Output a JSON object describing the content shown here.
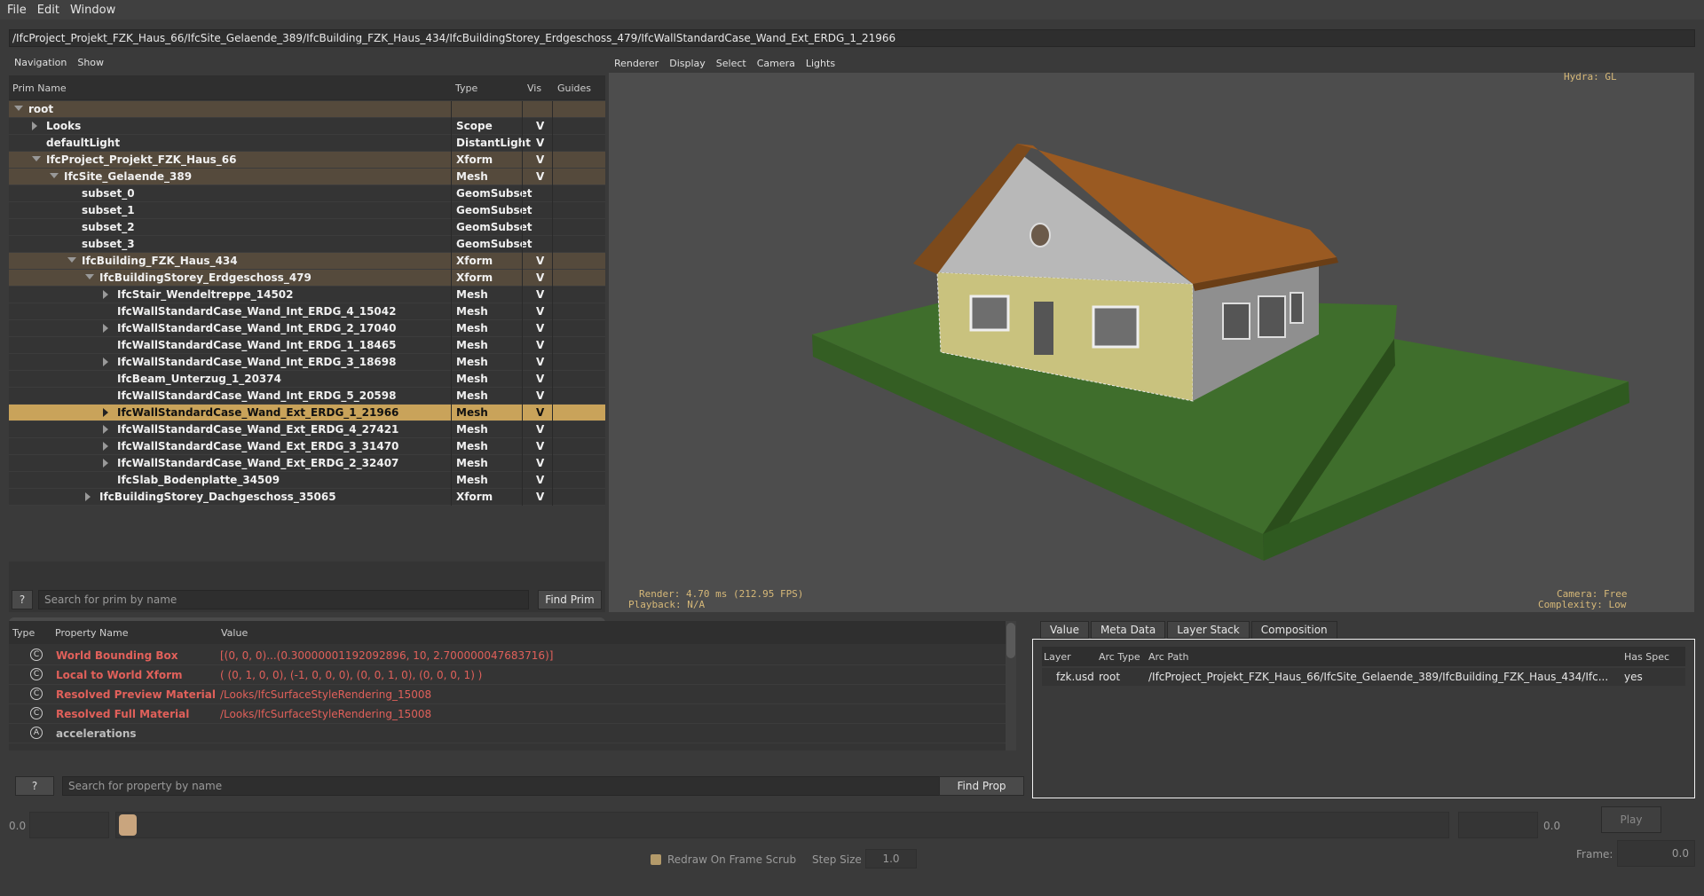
{
  "menu": [
    "File",
    "Edit",
    "Window"
  ],
  "path": "/IfcProject_Projekt_FZK_Haus_66/IfcSite_Gelaende_389/IfcBuilding_FZK_Haus_434/IfcBuildingStorey_Erdgeschoss_479/IfcWallStandardCase_Wand_Ext_ERDG_1_21966",
  "prim_panel": {
    "tabs": [
      "Navigation",
      "Show"
    ],
    "columns": [
      "Prim Name",
      "Type",
      "Vis",
      "Guides"
    ],
    "rows": [
      {
        "name": "root",
        "type": "",
        "vis": "",
        "depth": 0,
        "expander": "down",
        "style": "hl"
      },
      {
        "name": "Looks",
        "type": "Scope",
        "vis": "V",
        "depth": 1,
        "expander": "right",
        "style": ""
      },
      {
        "name": "defaultLight",
        "type": "DistantLight",
        "vis": "V",
        "depth": 1,
        "expander": "",
        "style": ""
      },
      {
        "name": "IfcProject_Projekt_FZK_Haus_66",
        "type": "Xform",
        "vis": "V",
        "depth": 1,
        "expander": "down",
        "style": "hl"
      },
      {
        "name": "IfcSite_Gelaende_389",
        "type": "Mesh",
        "vis": "V",
        "depth": 2,
        "expander": "down",
        "style": "hl"
      },
      {
        "name": "subset_0",
        "type": "GeomSubset",
        "vis": "",
        "depth": 3,
        "expander": "",
        "style": ""
      },
      {
        "name": "subset_1",
        "type": "GeomSubset",
        "vis": "",
        "depth": 3,
        "expander": "",
        "style": ""
      },
      {
        "name": "subset_2",
        "type": "GeomSubset",
        "vis": "",
        "depth": 3,
        "expander": "",
        "style": ""
      },
      {
        "name": "subset_3",
        "type": "GeomSubset",
        "vis": "",
        "depth": 3,
        "expander": "",
        "style": ""
      },
      {
        "name": "IfcBuilding_FZK_Haus_434",
        "type": "Xform",
        "vis": "V",
        "depth": 3,
        "expander": "down",
        "style": "hl"
      },
      {
        "name": "IfcBuildingStorey_Erdgeschoss_479",
        "type": "Xform",
        "vis": "V",
        "depth": 4,
        "expander": "down",
        "style": "hl"
      },
      {
        "name": "IfcStair_Wendeltreppe_14502",
        "type": "Mesh",
        "vis": "V",
        "depth": 5,
        "expander": "right",
        "style": ""
      },
      {
        "name": "IfcWallStandardCase_Wand_Int_ERDG_4_15042",
        "type": "Mesh",
        "vis": "V",
        "depth": 5,
        "expander": "",
        "style": ""
      },
      {
        "name": "IfcWallStandardCase_Wand_Int_ERDG_2_17040",
        "type": "Mesh",
        "vis": "V",
        "depth": 5,
        "expander": "right",
        "style": ""
      },
      {
        "name": "IfcWallStandardCase_Wand_Int_ERDG_1_18465",
        "type": "Mesh",
        "vis": "V",
        "depth": 5,
        "expander": "",
        "style": ""
      },
      {
        "name": "IfcWallStandardCase_Wand_Int_ERDG_3_18698",
        "type": "Mesh",
        "vis": "V",
        "depth": 5,
        "expander": "right",
        "style": ""
      },
      {
        "name": "IfcBeam_Unterzug_1_20374",
        "type": "Mesh",
        "vis": "V",
        "depth": 5,
        "expander": "",
        "style": ""
      },
      {
        "name": "IfcWallStandardCase_Wand_Int_ERDG_5_20598",
        "type": "Mesh",
        "vis": "V",
        "depth": 5,
        "expander": "",
        "style": ""
      },
      {
        "name": "IfcWallStandardCase_Wand_Ext_ERDG_1_21966",
        "type": "Mesh",
        "vis": "V",
        "depth": 5,
        "expander": "right",
        "style": "sel"
      },
      {
        "name": "IfcWallStandardCase_Wand_Ext_ERDG_4_27421",
        "type": "Mesh",
        "vis": "V",
        "depth": 5,
        "expander": "right",
        "style": ""
      },
      {
        "name": "IfcWallStandardCase_Wand_Ext_ERDG_3_31470",
        "type": "Mesh",
        "vis": "V",
        "depth": 5,
        "expander": "right",
        "style": ""
      },
      {
        "name": "IfcWallStandardCase_Wand_Ext_ERDG_2_32407",
        "type": "Mesh",
        "vis": "V",
        "depth": 5,
        "expander": "right",
        "style": ""
      },
      {
        "name": "IfcSlab_Bodenplatte_34509",
        "type": "Mesh",
        "vis": "V",
        "depth": 5,
        "expander": "",
        "style": ""
      },
      {
        "name": "IfcBuildingStorey_Dachgeschoss_35065",
        "type": "Xform",
        "vis": "V",
        "depth": 4,
        "expander": "right",
        "style": ""
      }
    ],
    "help_label": "?",
    "search_placeholder": "Search for prim by name",
    "find_label": "Find Prim"
  },
  "viewport": {
    "menu": [
      "Renderer",
      "Display",
      "Select",
      "Camera",
      "Lights"
    ],
    "hud_renderer": "Hydra: GL",
    "hud_render_time": "Render: 4.70 ms (212.95 FPS)",
    "hud_playback": "Playback: N/A",
    "hud_camera": "Camera: Free",
    "hud_complexity": "Complexity: Low",
    "colors": {
      "ground": "#3f6e2c",
      "wall": "#c9c27e",
      "side_wall": "#8f8f8f",
      "roof": "#9a5a22",
      "background": "#4d4d4d"
    }
  },
  "property_panel": {
    "columns": [
      "Type",
      "Property Name",
      "Value"
    ],
    "rows": [
      {
        "icon": "C",
        "name": "World Bounding Box",
        "value": "[(0, 0, 0)...(0.30000001192092896, 10, 2.700000047683716)]",
        "computed": true
      },
      {
        "icon": "C",
        "name": "Local to World Xform",
        "value": "( (0, 1, 0, 0), (-1, 0, 0, 0), (0, 0, 1, 0), (0, 0, 0, 1) )",
        "computed": true
      },
      {
        "icon": "C",
        "name": "Resolved Preview Material",
        "value": "/Looks/IfcSurfaceStyleRendering_15008",
        "computed": true
      },
      {
        "icon": "C",
        "name": "Resolved Full Material",
        "value": "/Looks/IfcSurfaceStyleRendering_15008",
        "computed": true
      },
      {
        "icon": "A",
        "name": "accelerations",
        "value": "",
        "computed": false
      }
    ],
    "help_label": "?",
    "search_placeholder": "Search for property by name",
    "find_label": "Find Prop"
  },
  "composition_panel": {
    "tabs": [
      "Value",
      "Meta Data",
      "Layer Stack",
      "Composition"
    ],
    "active_tab": "Composition",
    "columns": [
      "Layer",
      "Arc Type",
      "Arc Path",
      "Has Spec"
    ],
    "rows": [
      {
        "layer": "fzk.usd",
        "arc_type": "root",
        "arc_path": "/IfcProject_Projekt_FZK_Haus_66/IfcSite_Gelaende_389/IfcBuilding_FZK_Haus_434/Ifc...",
        "has_spec": "yes"
      }
    ]
  },
  "timeline": {
    "start": "0.0",
    "end": "0.0",
    "play_label": "Play",
    "redraw_label": "Redraw On Frame Scrub",
    "step_label": "Step Size",
    "step_value": "1.0",
    "frame_label": "Frame:",
    "frame_value": "0.0"
  }
}
